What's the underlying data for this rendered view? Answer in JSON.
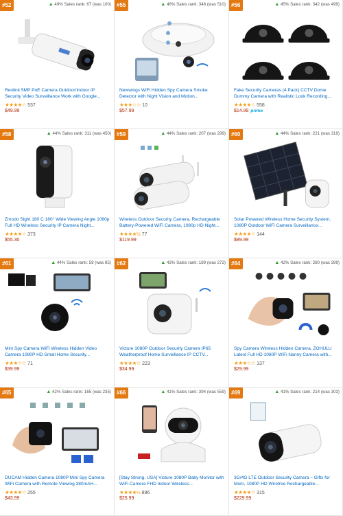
{
  "products": [
    {
      "rank": "#52",
      "change": "49%",
      "sales": "Sales rank: 67 (was 100)",
      "title": "Reolink 5MP PoE Camera Outdoor/Indoor IP Security Video Surveillance Work with Google...",
      "stars": "★★★★☆",
      "reviews": "537",
      "price": "$49.99",
      "icon": "bullet-camera-icon"
    },
    {
      "rank": "#55",
      "change": "46%",
      "sales": "Sales rank: 348 (was 510)",
      "title": "Newwings WiFi Hidden Spy Camera Smoke Detector with Night Vision and Motion...",
      "stars": "★★★☆☆",
      "reviews": "10",
      "price": "$57.99",
      "icon": "smoke-detector-camera-icon"
    },
    {
      "rank": "#56",
      "change": "45%",
      "sales": "Sales rank: 342 (was 499)",
      "title": "Fake Security Cameras (4 Pack) CCTV Dome Dummy Camera with Realistic Look Recording...",
      "stars": "★★★★☆",
      "reviews": "558",
      "price": "$14.99",
      "prime": "prime",
      "icon": "dome-cameras-icon"
    },
    {
      "rank": "#58",
      "change": "44%",
      "sales": "Sales rank: 311 (was 450)",
      "title": "Zmodo Sight 180 C 180° Wide Viewing Angle 1080p Full HD Wireless Security IP Camera Night...",
      "stars": "★★★★☆",
      "reviews": "373",
      "price": "$55.30",
      "icon": "indoor-camera-icon"
    },
    {
      "rank": "#59",
      "change": "44%",
      "sales": "Sales rank: 207 (was 299)",
      "title": "Wireless Outdoor Security Camera, Rechargeable Battery-Powered WiFi Camera, 1080p HD Night...",
      "stars": "★★★★½",
      "reviews": "77",
      "price": "$119.99",
      "icon": "twin-cameras-icon"
    },
    {
      "rank": "#60",
      "change": "44%",
      "sales": "Sales rank: 221 (was 319)",
      "title": "Solar Powered Wireless Home Security System, 1080P Outdoor WiFi Camera Surveillance...",
      "stars": "★★★★☆",
      "reviews": "144",
      "price": "$89.99",
      "icon": "solar-camera-icon"
    },
    {
      "rank": "#61",
      "change": "44%",
      "sales": "Sales rank: 59 (was 85)",
      "title": "Mini Spy Camera WiFi Wireless Hidden Video Camera 1080P HD Small Home Security...",
      "stars": "★★★☆☆",
      "reviews": "71",
      "price": "$39.99",
      "icon": "mini-spy-camera-icon"
    },
    {
      "rank": "#62",
      "change": "43%",
      "sales": "Sales rank: 189 (was 272)",
      "title": "Victure 1080P Outdoor Security Camera IP65 Weatherproof Home Surveillance IP CCTV...",
      "stars": "★★★★☆",
      "reviews": "223",
      "price": "$34.99",
      "icon": "outdoor-camera-icon"
    },
    {
      "rank": "#64",
      "change": "42%",
      "sales": "Sales rank: 280 (was 399)",
      "title": "Spy Camera Wireless Hidden Camera, ZOHULU Latest Full HD 1080P WiFi Nanny Camera with...",
      "stars": "★★★☆☆",
      "reviews": "137",
      "price": "$29.99",
      "icon": "hand-spy-camera-icon"
    },
    {
      "rank": "#65",
      "change": "42%",
      "sales": "Sales rank: 165 (was 235)",
      "title": "DUCAM Hidden Camera 1080P Mini Spy Camera WiFi Camera with Remote Viewing 380mAH...",
      "stars": "★★★★☆",
      "reviews": "255",
      "price": "$43.99",
      "icon": "cube-spy-camera-icon"
    },
    {
      "rank": "#66",
      "change": "41%",
      "sales": "Sales rank: 394 (was 559)",
      "title": "[Stay Strong, USA] Victure 1080P Baby Monitor with WiFi Camera FHD Indoor Wireless...",
      "stars": "★★★★½",
      "reviews": "896",
      "price": "$25.99",
      "icon": "baby-monitor-camera-icon"
    },
    {
      "rank": "#69",
      "change": "41%",
      "sales": "Sales rank: 214 (was 303)",
      "title": "3G/4G LTE Outdoor Security Camera – Gifts for Mom, 1080P HD Wirefree Rechargeable...",
      "stars": "★★★★☆",
      "reviews": "315",
      "price": "$229.99",
      "icon": "lte-camera-icon"
    }
  ],
  "colors": {
    "badge": "#e47911",
    "link": "#0066c0",
    "price": "#b12704",
    "star": "#f39c12",
    "arrow": "#2e9b2e"
  }
}
